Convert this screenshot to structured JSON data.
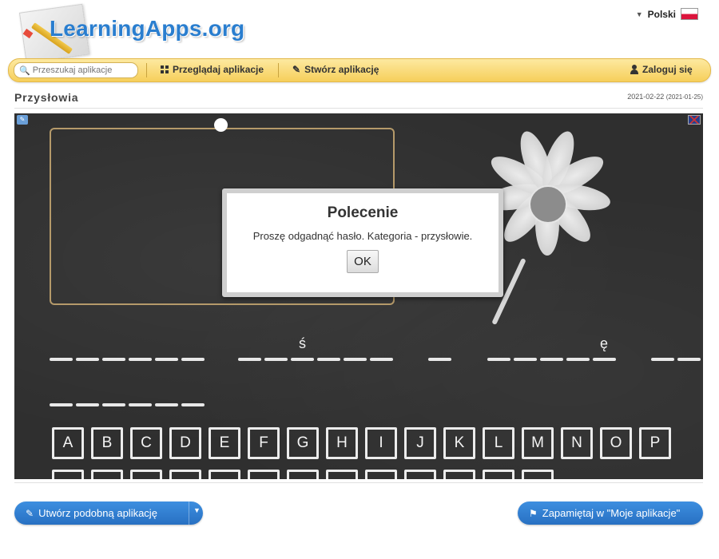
{
  "header": {
    "logo_text": "LearningApps.org",
    "language": "Polski"
  },
  "nav": {
    "search_placeholder": "Przeszukaj aplikacje",
    "browse": "Przeglądaj aplikacje",
    "create": "Stwórz aplikację",
    "login": "Zaloguj się"
  },
  "app": {
    "title": "Przysłowia",
    "date": "2021-02-22",
    "date_created": "(2021-01-25)"
  },
  "dialog": {
    "title": "Polecenie",
    "text": "Proszę odgadnąć hasło. Kategoria - przysłowie.",
    "ok": "OK"
  },
  "word_letters": [
    "ś",
    "ę"
  ],
  "keyboard": {
    "row1": [
      "A",
      "B",
      "C",
      "D",
      "E",
      "F",
      "G",
      "H",
      "I",
      "J",
      "K",
      "L",
      "M",
      "N",
      "O",
      "P"
    ]
  },
  "bottom": {
    "create_similar": "Utwórz podobną aplikację",
    "save_mine": "Zapamiętaj w \"Moje aplikacje\""
  }
}
